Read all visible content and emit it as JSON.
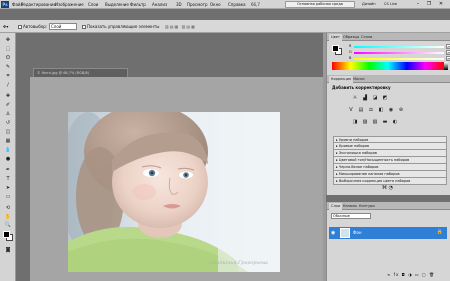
{
  "menubar": {
    "logo": "Ps",
    "items": [
      "Файл",
      "Редактирование",
      "Изображение",
      "Слои",
      "Выделение",
      "Фильтр",
      "Анализ",
      "3D",
      "Просмотр",
      "Окно",
      "Справка"
    ],
    "zoom": "66,7",
    "workspace": "Основная рабочая среда",
    "design": "Дизайн",
    "cslive": "CS Live"
  },
  "options": {
    "autoselect": "Автовыбор:",
    "layer_select": "Слой",
    "show_transform": "Показать управляющие элементы"
  },
  "document": {
    "tab": "© Фото.jpg @ 66,7% (RGB/8)",
    "watermark": "~Наталья Григорьева"
  },
  "color_panel": {
    "tabs": [
      "Цвет",
      "Образцы",
      "Стили"
    ],
    "channels": [
      {
        "label": "R",
        "value": "255"
      },
      {
        "label": "G",
        "value": "255"
      },
      {
        "label": "B",
        "value": "255"
      }
    ]
  },
  "adjustments": {
    "tabs": [
      "Коррекция",
      "Маски"
    ],
    "title": "Добавить корректировку",
    "presets": [
      "Уровни наборов",
      "Кривые наборов",
      "Экспозиция наборов",
      "Цветовой тон/Насыщенность наборов",
      "Черно-белое наборов",
      "Микширование каналов наборов",
      "Выборочная коррекция цвета наборов"
    ]
  },
  "layers": {
    "tabs": [
      "Слои",
      "Каналы",
      "Контуры"
    ],
    "blend": "Обычные",
    "layer_name": "Фон"
  },
  "colors": {
    "accent": "#2f7fd6",
    "chrome": "#d4d4d4",
    "canvas": "#6f6f6f"
  }
}
